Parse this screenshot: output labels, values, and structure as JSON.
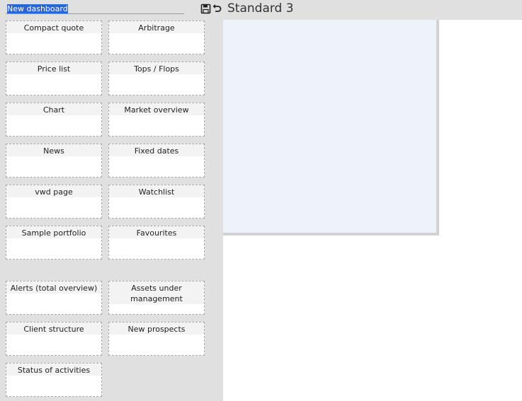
{
  "toolbar": {
    "dashboard_name_value": "New dashboard",
    "save_icon": "save-icon",
    "undo_icon": "undo-icon",
    "title": "Standard 3"
  },
  "widgets": [
    {
      "label": "Compact quote"
    },
    {
      "label": "Arbitrage"
    },
    {
      "label": "Price list"
    },
    {
      "label": "Tops / Flops"
    },
    {
      "label": "Chart"
    },
    {
      "label": "Market overview"
    },
    {
      "label": "News"
    },
    {
      "label": "Fixed dates"
    },
    {
      "label": "vwd page"
    },
    {
      "label": "Watchlist"
    },
    {
      "label": "Sample portfolio"
    },
    {
      "label": "Favourites"
    }
  ],
  "crm_widgets": [
    {
      "label": "Alerts (total overview)"
    },
    {
      "label": "Assets under management"
    },
    {
      "label": "Client structure"
    },
    {
      "label": "New prospects"
    },
    {
      "label": "Status of activities"
    }
  ],
  "colors": {
    "sidebar_bg": "#e0e0e0",
    "canvas_bg": "#eef3fb",
    "selection": "#2b63d8"
  }
}
